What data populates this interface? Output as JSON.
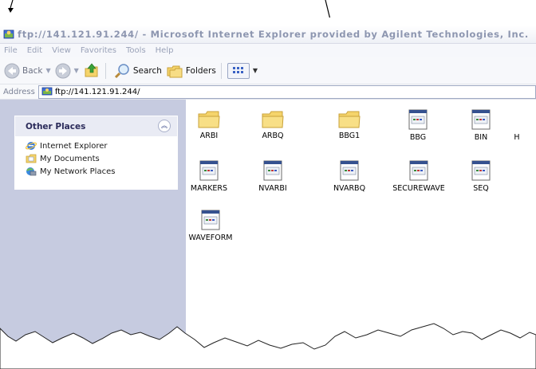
{
  "window": {
    "title": "ftp://141.121.91.244/ - Microsoft Internet Explorer provided by Agilent Technologies, Inc."
  },
  "menu": [
    "File",
    "Edit",
    "View",
    "Favorites",
    "Tools",
    "Help"
  ],
  "toolbar": {
    "back_label": "Back",
    "search_label": "Search",
    "folders_label": "Folders"
  },
  "address": {
    "label": "Address",
    "value": "ftp://141.121.91.244/"
  },
  "task_pane": {
    "title": "Other Places",
    "items": [
      {
        "label": "Internet Explorer",
        "icon": "internet-explorer-icon"
      },
      {
        "label": "My Documents",
        "icon": "my-documents-icon"
      },
      {
        "label": "My Network Places",
        "icon": "network-places-icon"
      }
    ]
  },
  "files": [
    {
      "name": "ARBI",
      "type": "folder"
    },
    {
      "name": "ARBQ",
      "type": "folder"
    },
    {
      "name": "BBG1",
      "type": "folder"
    },
    {
      "name": "BBG",
      "type": "file"
    },
    {
      "name": "BIN",
      "type": "file"
    },
    {
      "name": "H",
      "type": "partial"
    },
    {
      "name": "MARKERS",
      "type": "file"
    },
    {
      "name": "NVARBI",
      "type": "file"
    },
    {
      "name": "NVARBQ",
      "type": "file"
    },
    {
      "name": "SECUREWAVE",
      "type": "file"
    },
    {
      "name": "SEQ",
      "type": "file"
    },
    {
      "name": "WAVEFORM",
      "type": "file"
    }
  ],
  "colors": {
    "folder": "#f5d46b",
    "task_pane_bg": "#c6cbe0",
    "title_text": "#8d96b0"
  }
}
